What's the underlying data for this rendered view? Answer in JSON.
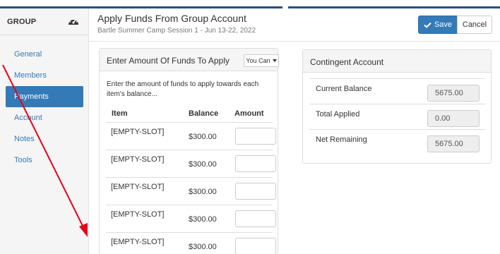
{
  "sidebar": {
    "title": "GROUP",
    "icon": "dashboard-icon",
    "items": [
      {
        "label": "General",
        "active": false
      },
      {
        "label": "Members",
        "active": false
      },
      {
        "label": "Payments",
        "active": true
      },
      {
        "label": "Account",
        "active": false
      },
      {
        "label": "Notes",
        "active": false
      },
      {
        "label": "Tools",
        "active": false
      }
    ]
  },
  "header": {
    "title": "Apply Funds From Group Account",
    "subtitle": "Bartle Summer Camp Session 1 - Jun 13-22, 2022",
    "save_label": "Save",
    "cancel_label": "Cancel"
  },
  "funds_panel": {
    "title": "Enter Amount Of Funds To Apply",
    "dropdown_label": "You Can",
    "instructions": "Enter the amount of funds to apply towards each item's balance...",
    "columns": [
      "Item",
      "Balance",
      "Amount"
    ],
    "rows": [
      {
        "item": "[EMPTY-SLOT]",
        "balance": "$300.00",
        "amount": ""
      },
      {
        "item": "[EMPTY-SLOT]",
        "balance": "$300.00",
        "amount": ""
      },
      {
        "item": "[EMPTY-SLOT]",
        "balance": "$300.00",
        "amount": ""
      },
      {
        "item": "[EMPTY-SLOT]",
        "balance": "$300.00",
        "amount": ""
      },
      {
        "item": "[EMPTY-SLOT]",
        "balance": "$300.00",
        "amount": ""
      }
    ]
  },
  "contingent_panel": {
    "title": "Contingent Account",
    "rows": [
      {
        "label": "Current Balance",
        "value": "5675.00"
      },
      {
        "label": "Total Applied",
        "value": "0.00"
      },
      {
        "label": "Net Remaining",
        "value": "5675.00"
      }
    ]
  },
  "colors": {
    "primary": "#337ab7",
    "annotation_arrow": "#e8001c",
    "topbar": "#2a4f7e"
  }
}
